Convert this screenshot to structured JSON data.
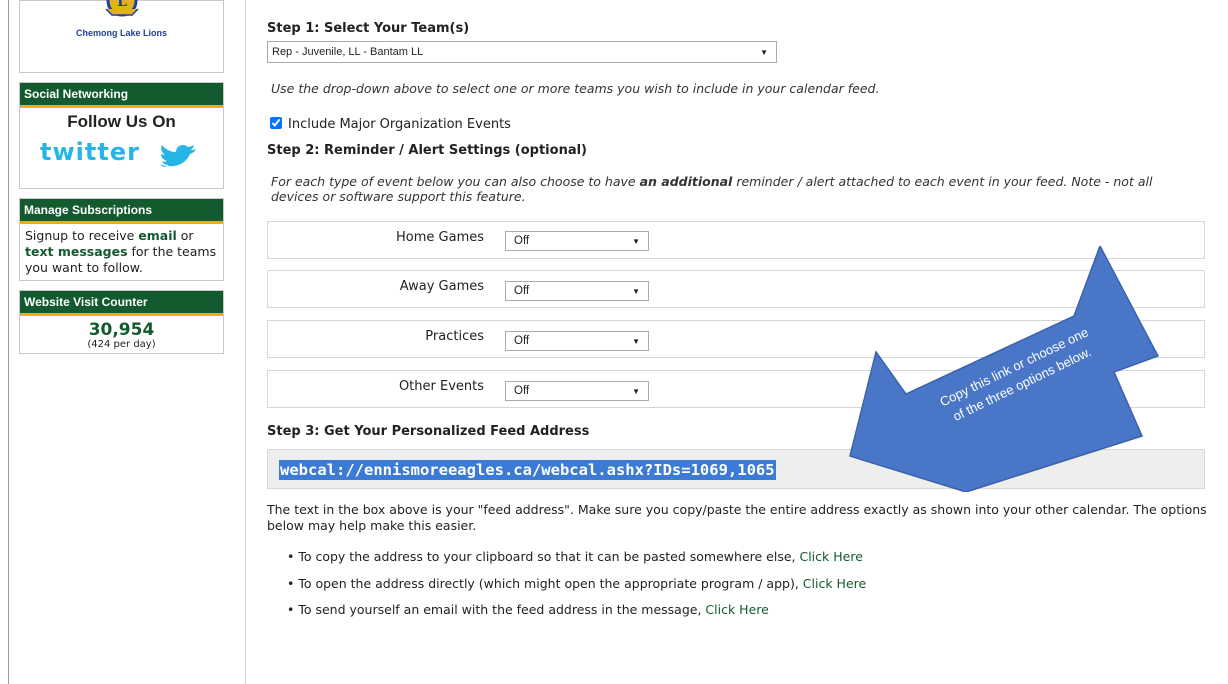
{
  "sidebar": {
    "logo_caption": "Chemong Lake Lions",
    "social": {
      "header": "Social Networking",
      "follow": "Follow Us On",
      "twitter_word": "twitter"
    },
    "subscriptions": {
      "header": "Manage Subscriptions",
      "text_1": "Signup to receive ",
      "email": "email",
      "text_2": " or ",
      "text_messages": "text messages",
      "text_3": " for the teams you want to follow."
    },
    "counter": {
      "header": "Website Visit Counter",
      "count": "30,954",
      "per_day": "(424 per day)"
    }
  },
  "step1": {
    "title": "Step 1: Select Your Team(s)",
    "selected_teams": "Rep - Juvenile, LL - Bantam LL",
    "help": "Use the drop-down above to select one or more teams you wish to include in your calendar feed.",
    "major_events_label": "Include Major Organization Events",
    "major_events_checked": true
  },
  "step2": {
    "title": "Step 2: Reminder / Alert Settings (optional)",
    "help_1": "For each type of event below you can also choose to have ",
    "help_bold": "an additional",
    "help_2": " reminder / alert attached to each event in your feed.  Note - not all devices or software support this feature.",
    "rows": [
      {
        "label": "Home Games",
        "value": "Off"
      },
      {
        "label": "Away Games",
        "value": "Off"
      },
      {
        "label": "Practices",
        "value": "Off"
      },
      {
        "label": "Other Events",
        "value": "Off"
      }
    ]
  },
  "step3": {
    "title": "Step 3: Get Your Personalized Feed Address",
    "feed_address": "webcal://ennismoreeagles.ca/webcal.ashx?IDs=1069,1065",
    "explanation": "The text in the box above is your \"feed address\". Make sure you copy/paste the entire address exactly as shown into your other calendar. The options below may help make this easier.",
    "options": [
      {
        "text": "• To copy the address to your clipboard so that it can be pasted somewhere else, ",
        "link": "Click Here"
      },
      {
        "text": "• To open the address directly (which might open the appropriate program / app), ",
        "link": "Click Here"
      },
      {
        "text": "• To send yourself an email with the feed address in the message, ",
        "link": "Click Here"
      }
    ]
  },
  "callout": {
    "line_1": "Copy this link or choose one",
    "line_2": "of the three options below.",
    "color": "#4a76c8"
  },
  "colors": {
    "brand_green": "#135a2f",
    "brand_gold": "#e0b21f",
    "selection_blue": "#3b7bd6"
  }
}
